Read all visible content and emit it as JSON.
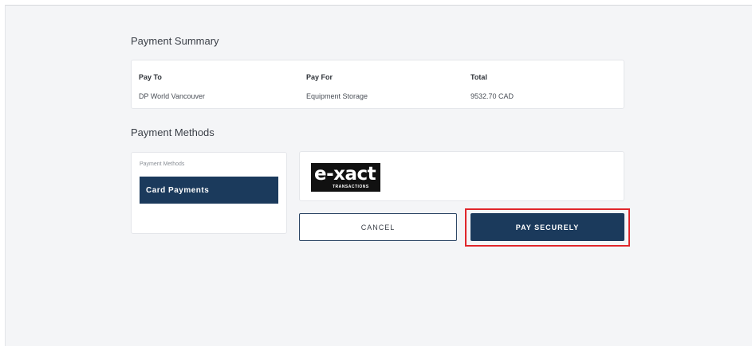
{
  "summary": {
    "title": "Payment Summary",
    "columns": [
      {
        "header": "Pay To",
        "value": "DP World Vancouver"
      },
      {
        "header": "Pay For",
        "value": "Equipment Storage"
      },
      {
        "header": "Total",
        "value": "9532.70 CAD"
      }
    ]
  },
  "methods": {
    "title": "Payment Methods",
    "panel_label": "Payment Methods",
    "selected_method": "Card Payments"
  },
  "provider": {
    "logo_main": "e-xact",
    "logo_sub": "TRANSACTIONS"
  },
  "actions": {
    "cancel_label": "CANCEL",
    "pay_label": "PAY SECURELY"
  },
  "colors": {
    "primary": "#1b3a5c",
    "highlight": "#e0262b"
  }
}
